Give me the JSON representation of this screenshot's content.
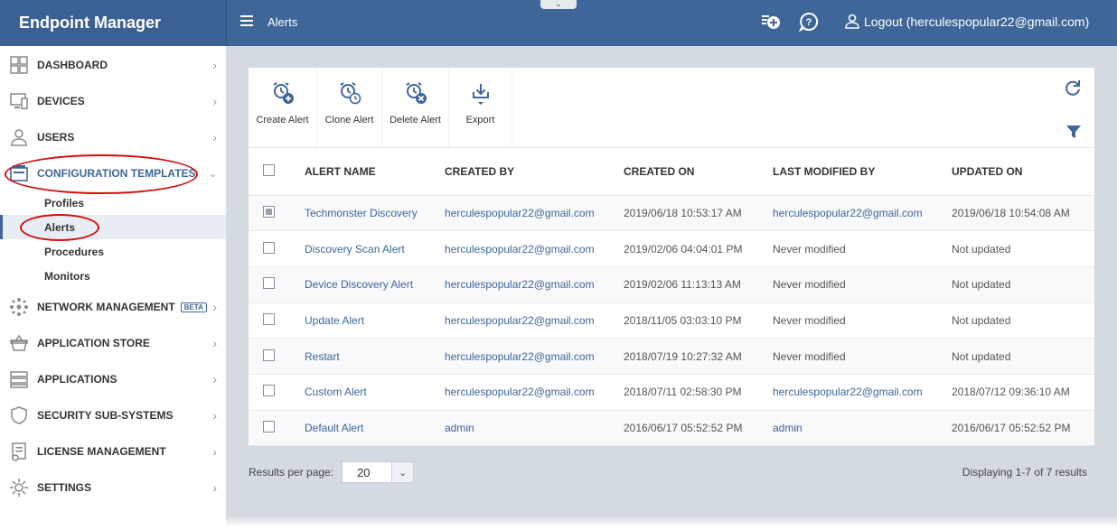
{
  "header": {
    "brand": "Endpoint Manager",
    "breadcrumb": "Alerts",
    "logout_label": "Logout (herculespopular22@gmail.com)"
  },
  "sidebar": {
    "items": [
      {
        "label": "DASHBOARD",
        "icon": "dashboard-icon"
      },
      {
        "label": "DEVICES",
        "icon": "devices-icon"
      },
      {
        "label": "USERS",
        "icon": "users-icon"
      },
      {
        "label": "CONFIGURATION TEMPLATES",
        "icon": "configuration-templates-icon"
      },
      {
        "label": "NETWORK MANAGEMENT",
        "icon": "network-icon",
        "badge": "BETA"
      },
      {
        "label": "APPLICATION STORE",
        "icon": "store-icon"
      },
      {
        "label": "APPLICATIONS",
        "icon": "applications-icon"
      },
      {
        "label": "SECURITY SUB-SYSTEMS",
        "icon": "shield-icon"
      },
      {
        "label": "LICENSE MANAGEMENT",
        "icon": "license-icon"
      },
      {
        "label": "SETTINGS",
        "icon": "gear-icon"
      }
    ],
    "sub_items": [
      "Profiles",
      "Alerts",
      "Procedures",
      "Monitors"
    ]
  },
  "toolbar": {
    "create": "Create Alert",
    "clone": "Clone Alert",
    "delete": "Delete Alert",
    "export": "Export"
  },
  "table": {
    "headers": [
      "ALERT NAME",
      "CREATED BY",
      "CREATED ON",
      "LAST MODIFIED BY",
      "UPDATED ON"
    ],
    "rows": [
      {
        "name": "Techmonster Discovery",
        "created_by": "herculespopular22@gmail.com",
        "created_on": "2019/06/18 10:53:17 AM",
        "modified_by": "herculespopular22@gmail.com",
        "updated_on": "2019/06/18 10:54:08 AM",
        "checked": true,
        "modified_link": true
      },
      {
        "name": "Discovery Scan Alert",
        "created_by": "herculespopular22@gmail.com",
        "created_on": "2019/02/06 04:04:01 PM",
        "modified_by": "Never modified",
        "updated_on": "Not updated",
        "checked": false,
        "modified_link": false
      },
      {
        "name": "Device Discovery Alert",
        "created_by": "herculespopular22@gmail.com",
        "created_on": "2019/02/06 11:13:13 AM",
        "modified_by": "Never modified",
        "updated_on": "Not updated",
        "checked": false,
        "modified_link": false
      },
      {
        "name": "Update Alert",
        "created_by": "herculespopular22@gmail.com",
        "created_on": "2018/11/05 03:03:10 PM",
        "modified_by": "Never modified",
        "updated_on": "Not updated",
        "checked": false,
        "modified_link": false
      },
      {
        "name": "Restart",
        "created_by": "herculespopular22@gmail.com",
        "created_on": "2018/07/19 10:27:32 AM",
        "modified_by": "Never modified",
        "updated_on": "Not updated",
        "checked": false,
        "modified_link": false
      },
      {
        "name": "Custom Alert",
        "created_by": "herculespopular22@gmail.com",
        "created_on": "2018/07/11 02:58:30 PM",
        "modified_by": "herculespopular22@gmail.com",
        "updated_on": "2018/07/12 09:36:10 AM",
        "checked": false,
        "modified_link": true
      },
      {
        "name": "Default Alert",
        "created_by": "admin",
        "created_on": "2016/06/17 05:52:52 PM",
        "modified_by": "admin",
        "updated_on": "2016/06/17 05:52:52 PM",
        "checked": false,
        "modified_link": true
      }
    ]
  },
  "footer": {
    "results_label": "Results per page:",
    "per_page": "20",
    "displaying": "Displaying 1-7 of 7 results"
  },
  "colors": {
    "brand": "#3e6699",
    "link": "#3e6699",
    "annotation": "#d20f0f"
  }
}
